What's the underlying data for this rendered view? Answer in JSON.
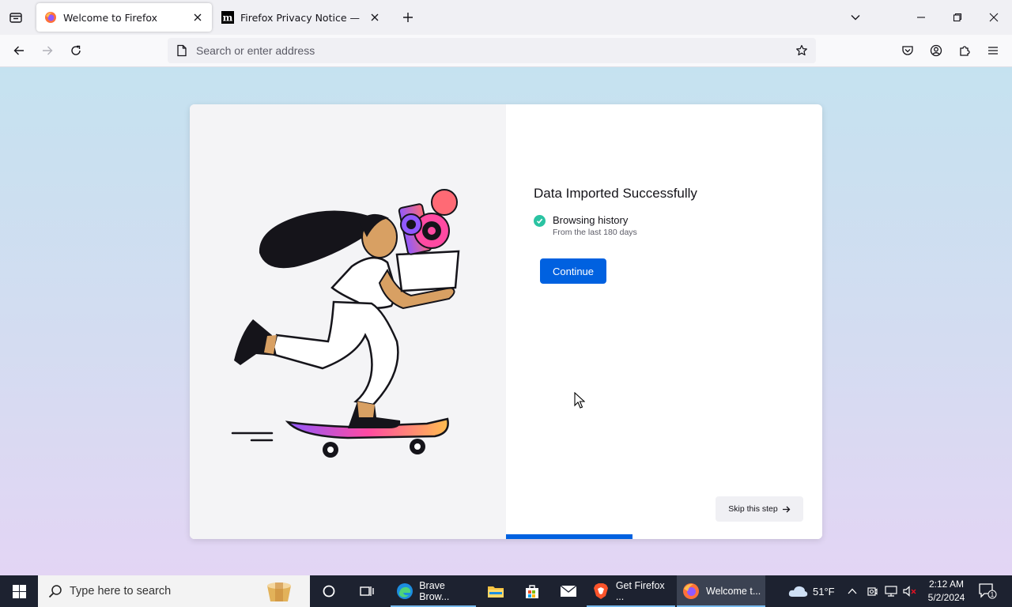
{
  "browser": {
    "tabs": [
      {
        "title": "Welcome to Firefox",
        "active": true,
        "icon": "firefox-icon"
      },
      {
        "title": "Firefox Privacy Notice — Mozilla",
        "active": false,
        "icon": "mozilla-m-icon"
      }
    ],
    "address_placeholder": "Search or enter address"
  },
  "onboarding": {
    "heading": "Data Imported Successfully",
    "item_label": "Browsing history",
    "item_sub": "From the last 180 days",
    "continue_label": "Continue",
    "skip_label": "Skip this step",
    "progress": 0.4,
    "colors": {
      "primary": "#0061e0",
      "check": "#2ac3a2"
    }
  },
  "taskbar": {
    "search_placeholder": "Type here to search",
    "apps": [
      {
        "label": "Brave Brow...",
        "icon": "edge-icon"
      },
      {
        "label": "Get Firefox ...",
        "icon": "brave-icon"
      },
      {
        "label": "Welcome t...",
        "icon": "firefox-icon",
        "active": true
      }
    ],
    "weather": "51°F",
    "time": "2:12 AM",
    "date": "5/2/2024",
    "notifications": "1"
  }
}
